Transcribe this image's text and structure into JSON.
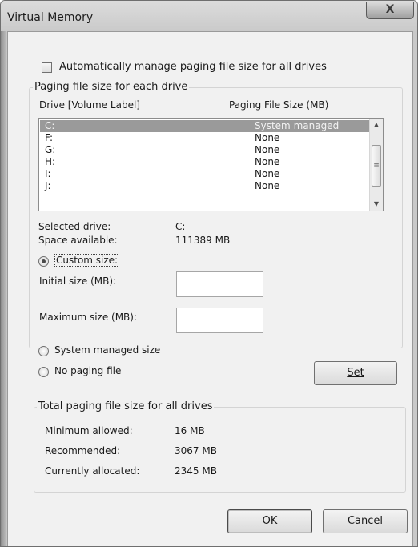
{
  "window": {
    "title": "Virtual Memory",
    "close_label": "X"
  },
  "auto_manage": {
    "label": "Automatically manage paging file size for all drives",
    "checked": false
  },
  "per_drive": {
    "group_title": "Paging file size for each drive",
    "col_drive": "Drive  [Volume Label]",
    "col_size": "Paging File Size (MB)",
    "drives": [
      {
        "drive": "C:",
        "size": "System managed",
        "selected": true
      },
      {
        "drive": "F:",
        "size": "None",
        "selected": false
      },
      {
        "drive": "G:",
        "size": "None",
        "selected": false
      },
      {
        "drive": "H:",
        "size": "None",
        "selected": false
      },
      {
        "drive": "I:",
        "size": "None",
        "selected": false
      },
      {
        "drive": "J:",
        "size": "None",
        "selected": false
      }
    ],
    "selected_drive_label": "Selected drive:",
    "selected_drive_value": "C:",
    "space_available_label": "Space available:",
    "space_available_value": "111389 MB",
    "custom_size_label": "Custom size:",
    "initial_size_label": "Initial size (MB):",
    "initial_size_value": "",
    "maximum_size_label": "Maximum size (MB):",
    "maximum_size_value": "",
    "system_managed_label": "System managed size",
    "no_paging_label": "No paging file",
    "selected_option": "custom",
    "set_label": "Set"
  },
  "totals": {
    "group_title": "Total paging file size for all drives",
    "min_label": "Minimum allowed:",
    "min_value": "16 MB",
    "rec_label": "Recommended:",
    "rec_value": "3067 MB",
    "alloc_label": "Currently allocated:",
    "alloc_value": "2345 MB"
  },
  "buttons": {
    "ok": "OK",
    "cancel": "Cancel"
  },
  "colors": {
    "selection": "#9a9a9a",
    "dialog_bg": "#f1f1f1",
    "frame": "#c9c9c9"
  },
  "icons": {
    "close": "close-icon",
    "scroll_up": "scroll-up-arrow-icon",
    "scroll_down": "scroll-down-arrow-icon",
    "scroll_grip": "scroll-grip-icon"
  }
}
